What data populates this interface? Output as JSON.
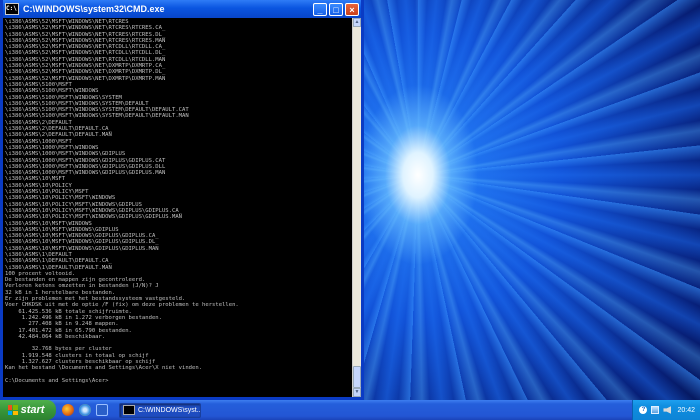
{
  "window": {
    "title": "C:\\WINDOWS\\system32\\CMD.exe",
    "icon_text": "C:\\",
    "minimize_label": "_",
    "maximize_label": "□",
    "close_label": "×"
  },
  "console": {
    "lines": [
      "\\i386\\ASMS\\52\\MSFT\\WINDOWS\\NET\\RTCRES",
      "\\i386\\ASMS\\52\\MSFT\\WINDOWS\\NET\\RTCRES\\RTCRES.CA_",
      "\\i386\\ASMS\\52\\MSFT\\WINDOWS\\NET\\RTCRES\\RTCRES.DL_",
      "\\i386\\ASMS\\52\\MSFT\\WINDOWS\\NET\\RTCRES\\RTCRES.MAN",
      "\\i386\\ASMS\\52\\MSFT\\WINDOWS\\NET\\RTCDLL\\RTCDLL.CA_",
      "\\i386\\ASMS\\52\\MSFT\\WINDOWS\\NET\\RTCDLL\\RTCDLL.DL_",
      "\\i386\\ASMS\\52\\MSFT\\WINDOWS\\NET\\RTCDLL\\RTCDLL.MAN",
      "\\i386\\ASMS\\52\\MSFT\\WINDOWS\\NET\\DXMRTP\\DXMRTP.CA_",
      "\\i386\\ASMS\\52\\MSFT\\WINDOWS\\NET\\DXMRTP\\DXMRTP.DL_",
      "\\i386\\ASMS\\52\\MSFT\\WINDOWS\\NET\\DXMRTP\\DXMRTP.MAN",
      "\\i386\\ASMS\\5100\\MSFT",
      "\\i386\\ASMS\\5100\\MSFT\\WINDOWS",
      "\\i386\\ASMS\\5100\\MSFT\\WINDOWS\\SYSTEM",
      "\\i386\\ASMS\\5100\\MSFT\\WINDOWS\\SYSTEM\\DEFAULT",
      "\\i386\\ASMS\\5100\\MSFT\\WINDOWS\\SYSTEM\\DEFAULT\\DEFAULT.CAT",
      "\\i386\\ASMS\\5100\\MSFT\\WINDOWS\\SYSTEM\\DEFAULT\\DEFAULT.MAN",
      "\\i386\\ASMS\\2\\DEFAULT",
      "\\i386\\ASMS\\2\\DEFAULT\\DEFAULT.CA_",
      "\\i386\\ASMS\\2\\DEFAULT\\DEFAULT.MAN",
      "\\i386\\ASMS\\1000\\MSFT",
      "\\i386\\ASMS\\1000\\MSFT\\WINDOWS",
      "\\i386\\ASMS\\1000\\MSFT\\WINDOWS\\GDIPLUS",
      "\\i386\\ASMS\\1000\\MSFT\\WINDOWS\\GDIPLUS\\GDIPLUS.CAT",
      "\\i386\\ASMS\\1000\\MSFT\\WINDOWS\\GDIPLUS\\GDIPLUS.DLL",
      "\\i386\\ASMS\\1000\\MSFT\\WINDOWS\\GDIPLUS\\GDIPLUS.MAN",
      "\\i386\\ASMS\\10\\MSFT",
      "\\i386\\ASMS\\10\\POLICY",
      "\\i386\\ASMS\\10\\POLICY\\MSFT",
      "\\i386\\ASMS\\10\\POLICY\\MSFT\\WINDOWS",
      "\\i386\\ASMS\\10\\POLICY\\MSFT\\WINDOWS\\GDIPLUS",
      "\\i386\\ASMS\\10\\POLICY\\MSFT\\WINDOWS\\GDIPLUS\\GDIPLUS.CA_",
      "\\i386\\ASMS\\10\\POLICY\\MSFT\\WINDOWS\\GDIPLUS\\GDIPLUS.MAN",
      "\\i386\\ASMS\\10\\MSFT\\WINDOWS",
      "\\i386\\ASMS\\10\\MSFT\\WINDOWS\\GDIPLUS",
      "\\i386\\ASMS\\10\\MSFT\\WINDOWS\\GDIPLUS\\GDIPLUS.CA_",
      "\\i386\\ASMS\\10\\MSFT\\WINDOWS\\GDIPLUS\\GDIPLUS.DL_",
      "\\i386\\ASMS\\10\\MSFT\\WINDOWS\\GDIPLUS\\GDIPLUS.MAN",
      "\\i386\\ASMS\\1\\DEFAULT",
      "\\i386\\ASMS\\1\\DEFAULT\\DEFAULT.CA_",
      "\\i386\\ASMS\\1\\DEFAULT\\DEFAULT.MAN",
      "100 procent voltooid.",
      "De bestanden en mappen zijn gecontroleerd.",
      "Verloren ketens omzetten in bestanden (J/N)? J",
      "32 kB in 1 herstelbare bestanden.",
      "Er zijn problemen met het bestandssysteem vastgesteld.",
      "Voer CHKDSK uit met de optie /F (fix) om deze problemen te herstellen.",
      "    61.425.536 kB totale schijfruimte.",
      "     1.242.496 kB in 1.272 verborgen bestanden.",
      "       277.408 kB in 9.248 mappen.",
      "    17.401.472 kB in 65.790 bestanden.",
      "    42.484.064 kB beschikbaar.",
      "",
      "        32.768 bytes per cluster",
      "     1.919.548 clusters in totaal op schijf",
      "     1.327.627 clusters beschikbaar op schijf",
      "Kan het bestand \\Documents and Settings\\Acer\\X niet vinden.",
      "",
      "C:\\Documents and Settings\\Acer>"
    ]
  },
  "taskbar": {
    "start_label": "start",
    "task_label": "C:\\WINDOWS\\syst...",
    "help_label": "?",
    "clock": "20:42"
  },
  "colors": {
    "console_bg": "#000000",
    "console_text": "#c0c0c0",
    "titlebar": "#0a55e0",
    "start_green": "#38963a"
  }
}
